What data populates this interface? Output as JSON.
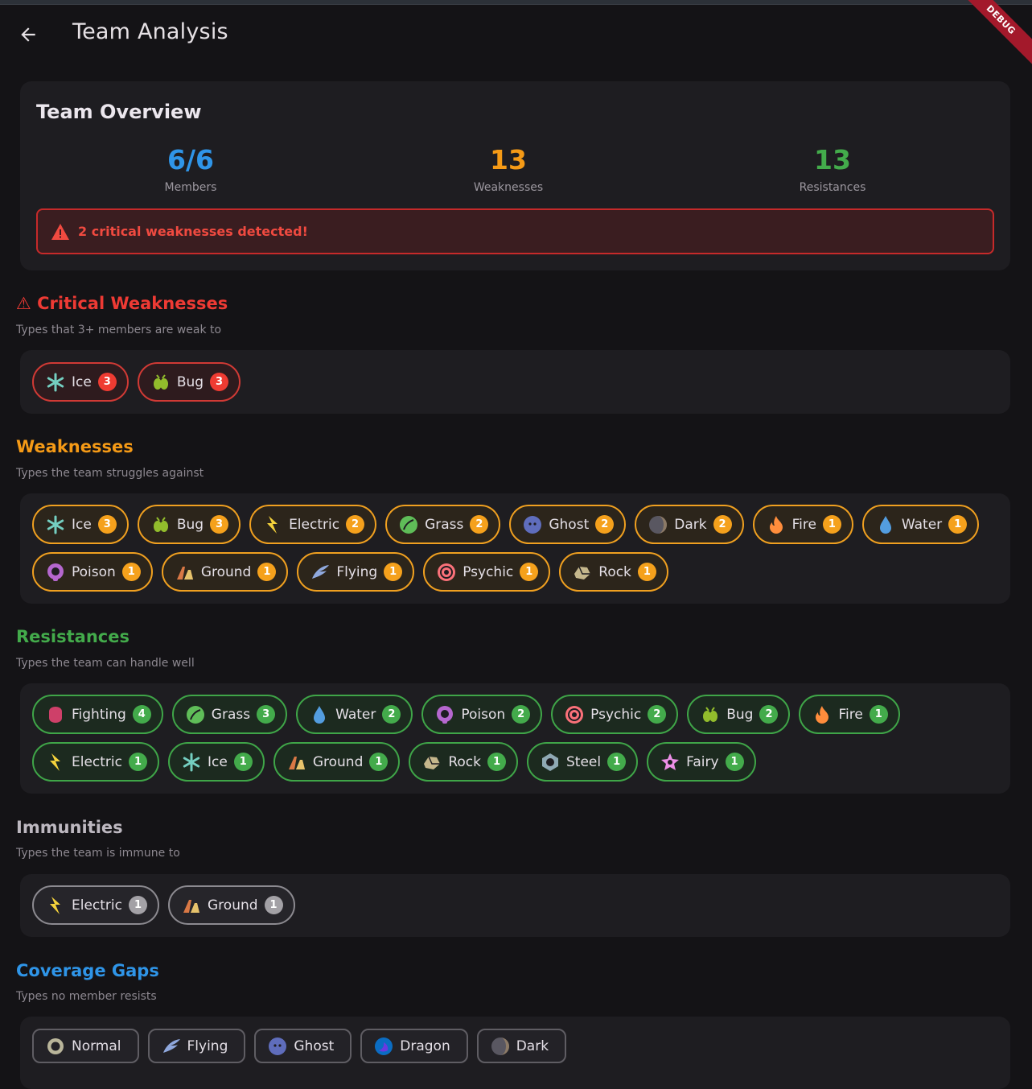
{
  "app": {
    "title": "Team Analysis",
    "debug_label": "DEBUG"
  },
  "overview": {
    "title": "Team Overview",
    "stats": [
      {
        "value": "6/6",
        "label": "Members",
        "color": "#2f95e8"
      },
      {
        "value": "13",
        "label": "Weaknesses",
        "color": "#f59a16"
      },
      {
        "value": "13",
        "label": "Resistances",
        "color": "#43ab4b"
      }
    ],
    "alert": "2 critical weaknesses detected!"
  },
  "sections": {
    "critical": {
      "title": "⚠ Critical Weaknesses",
      "subtitle": "Types that 3+ members are weak to",
      "color": "#ee3a34"
    },
    "weaknesses": {
      "title": "Weaknesses",
      "subtitle": "Types the team struggles against",
      "color": "#f59a16"
    },
    "resistances": {
      "title": "Resistances",
      "subtitle": "Types the team can handle well",
      "color": "#43ab4b"
    },
    "immunities": {
      "title": "Immunities",
      "subtitle": "Types the team is immune to",
      "color": "#bdb8c0"
    },
    "gaps": {
      "title": "Coverage Gaps",
      "subtitle": "Types no member resists",
      "color": "#2f95e8"
    }
  },
  "critical": [
    {
      "type": "Ice",
      "count": "3",
      "icon": "ice-icon"
    },
    {
      "type": "Bug",
      "count": "3",
      "icon": "bug-icon"
    }
  ],
  "weaknesses_row1": [
    {
      "type": "Ice",
      "count": "3",
      "icon": "ice-icon"
    },
    {
      "type": "Bug",
      "count": "3",
      "icon": "bug-icon"
    },
    {
      "type": "Electric",
      "count": "2",
      "icon": "electric-icon"
    },
    {
      "type": "Grass",
      "count": "2",
      "icon": "grass-icon"
    },
    {
      "type": "Ghost",
      "count": "2",
      "icon": "ghost-icon"
    },
    {
      "type": "Dark",
      "count": "2",
      "icon": "dark-icon"
    },
    {
      "type": "Fire",
      "count": "1",
      "icon": "fire-icon"
    },
    {
      "type": "Water",
      "count": "1",
      "icon": "water-icon"
    }
  ],
  "weaknesses_row2": [
    {
      "type": "Poison",
      "count": "1",
      "icon": "poison-icon"
    },
    {
      "type": "Ground",
      "count": "1",
      "icon": "ground-icon"
    },
    {
      "type": "Flying",
      "count": "1",
      "icon": "flying-icon"
    },
    {
      "type": "Psychic",
      "count": "1",
      "icon": "psychic-icon"
    },
    {
      "type": "Rock",
      "count": "1",
      "icon": "rock-icon"
    }
  ],
  "resistances_row1": [
    {
      "type": "Fighting",
      "count": "4",
      "icon": "fighting-icon"
    },
    {
      "type": "Grass",
      "count": "3",
      "icon": "grass-icon"
    },
    {
      "type": "Water",
      "count": "2",
      "icon": "water-icon"
    },
    {
      "type": "Poison",
      "count": "2",
      "icon": "poison-icon"
    },
    {
      "type": "Psychic",
      "count": "2",
      "icon": "psychic-icon"
    },
    {
      "type": "Bug",
      "count": "2",
      "icon": "bug-icon"
    },
    {
      "type": "Fire",
      "count": "1",
      "icon": "fire-icon"
    }
  ],
  "resistances_row2": [
    {
      "type": "Electric",
      "count": "1",
      "icon": "electric-icon"
    },
    {
      "type": "Ice",
      "count": "1",
      "icon": "ice-icon"
    },
    {
      "type": "Ground",
      "count": "1",
      "icon": "ground-icon"
    },
    {
      "type": "Rock",
      "count": "1",
      "icon": "rock-icon"
    },
    {
      "type": "Steel",
      "count": "1",
      "icon": "steel-icon"
    },
    {
      "type": "Fairy",
      "count": "1",
      "icon": "fairy-icon"
    }
  ],
  "immunities": [
    {
      "type": "Electric",
      "count": "1",
      "icon": "electric-icon"
    },
    {
      "type": "Ground",
      "count": "1",
      "icon": "ground-icon"
    }
  ],
  "gaps": [
    {
      "type": "Normal",
      "icon": "normal-icon"
    },
    {
      "type": "Flying",
      "icon": "flying-icon"
    },
    {
      "type": "Ghost",
      "icon": "ghost-icon"
    },
    {
      "type": "Dragon",
      "icon": "dragon-icon"
    },
    {
      "type": "Dark",
      "icon": "dark-icon"
    }
  ]
}
